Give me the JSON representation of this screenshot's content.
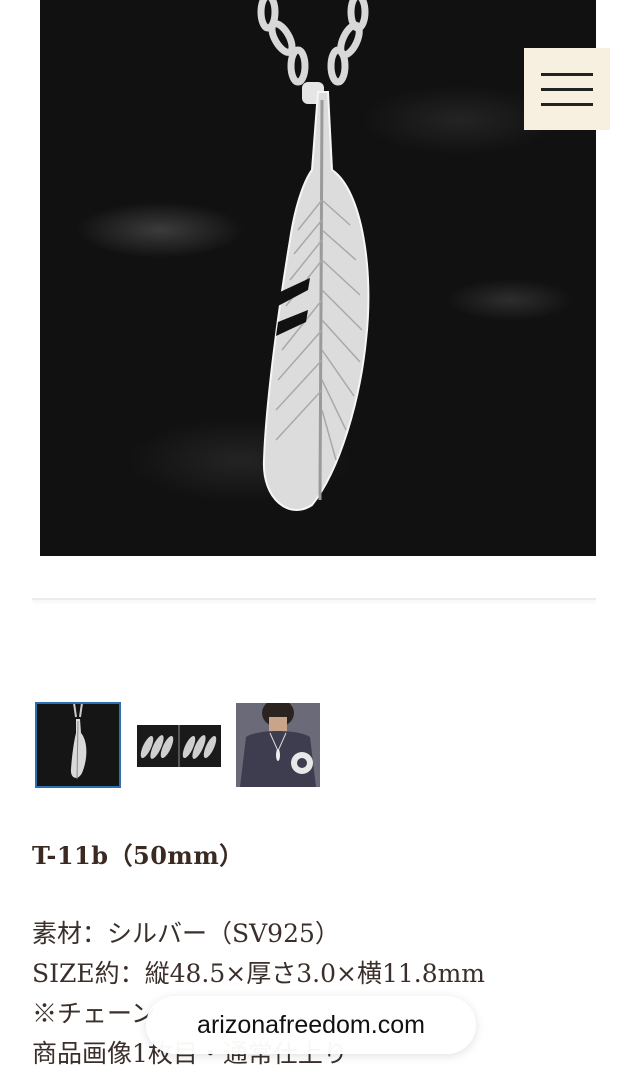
{
  "product": {
    "title": "T-11b（50mm）",
    "description_lines": [
      "素材：シルバー（SV925）",
      "SIZE約：縦48.5×厚さ3.0×横11.8mm",
      "※チェーン",
      "商品画像1枚目・通常仕上り"
    ]
  },
  "gallery": {
    "main_image_alt": "feather-pendant-on-black-stone",
    "thumbnails": [
      "thumbnail-feather-pendant",
      "thumbnail-feather-set",
      "thumbnail-model-wearing"
    ],
    "selected_index": 0
  },
  "url_bar": {
    "domain": "arizonafreedom.com"
  },
  "menu": {
    "icon": "hamburger-menu-icon"
  },
  "colors": {
    "title": "#3a2a22",
    "text": "#3a2f2a",
    "menu_bg": "#f7efdf",
    "thumbnail_selected_border": "#2c6fb2"
  }
}
